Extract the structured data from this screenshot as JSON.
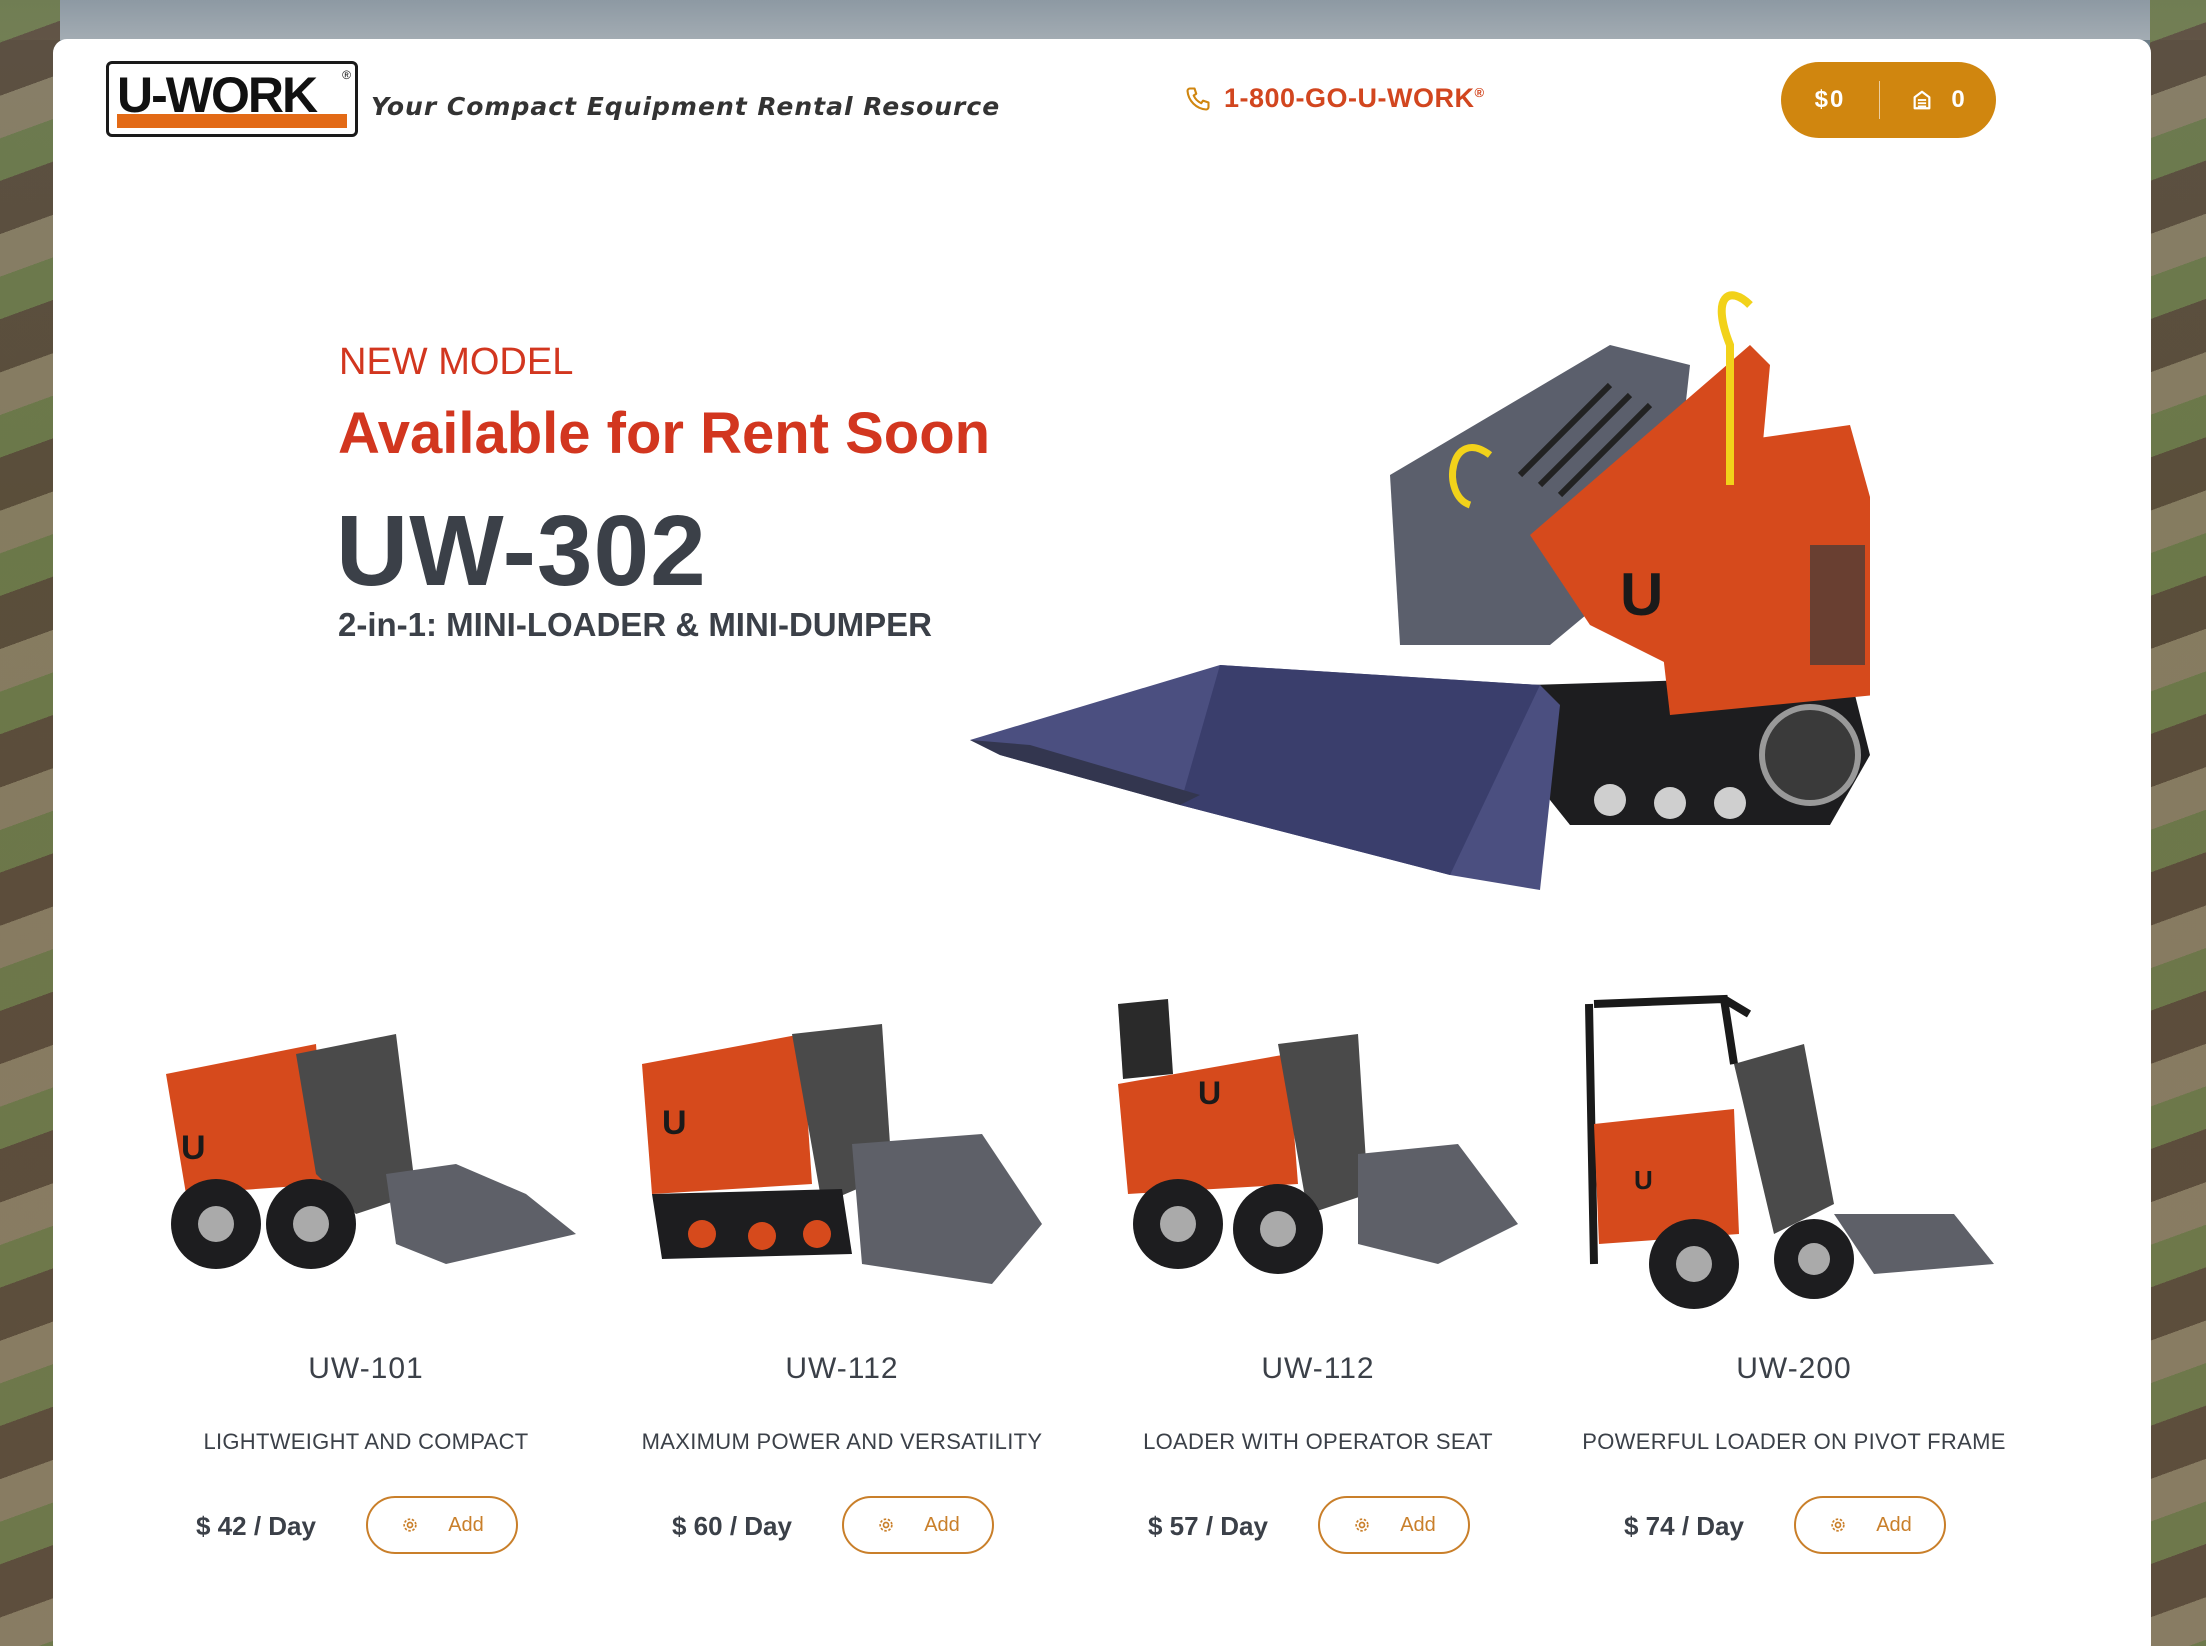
{
  "header": {
    "logo_text": "U-WORK",
    "logo_reg": "®",
    "tagline": "Your Compact Equipment Rental Resource",
    "phone": "1-800-GO-U-WORK",
    "phone_reg": "®",
    "cart_amount": "$0",
    "cart_count": "0"
  },
  "hero": {
    "eyebrow": "NEW MODEL",
    "headline": "Available for Rent Soon",
    "model": "UW-302",
    "subtitle": "2-in-1: MINI-LOADER & MINI-DUMPER",
    "machine_badge": "U"
  },
  "products": [
    {
      "model": "UW-101",
      "desc": "LIGHTWEIGHT AND COMPACT",
      "price": "$ 42 / Day",
      "add_label": "Add",
      "badge": "U"
    },
    {
      "model": "UW-112",
      "desc": "MAXIMUM POWER AND VERSATILITY",
      "price": "$ 60 / Day",
      "add_label": "Add",
      "badge": "U"
    },
    {
      "model": "UW-112",
      "desc": "LOADER WITH OPERATOR SEAT",
      "price": "$ 57 / Day",
      "add_label": "Add",
      "badge": "U"
    },
    {
      "model": "UW-200",
      "desc": "POWERFUL LOADER ON PIVOT FRAME",
      "price": "$ 74 / Day",
      "add_label": "Add",
      "badge": "U"
    }
  ],
  "colors": {
    "accent_red": "#d2361f",
    "accent_orange": "#d0860f",
    "text_dark": "#3b4048",
    "machine_orange": "#d64a1c",
    "bucket_gray": "#5e6068"
  },
  "icons": {
    "phone": "phone-icon",
    "cart": "cart-icon",
    "add": "gear-icon"
  }
}
